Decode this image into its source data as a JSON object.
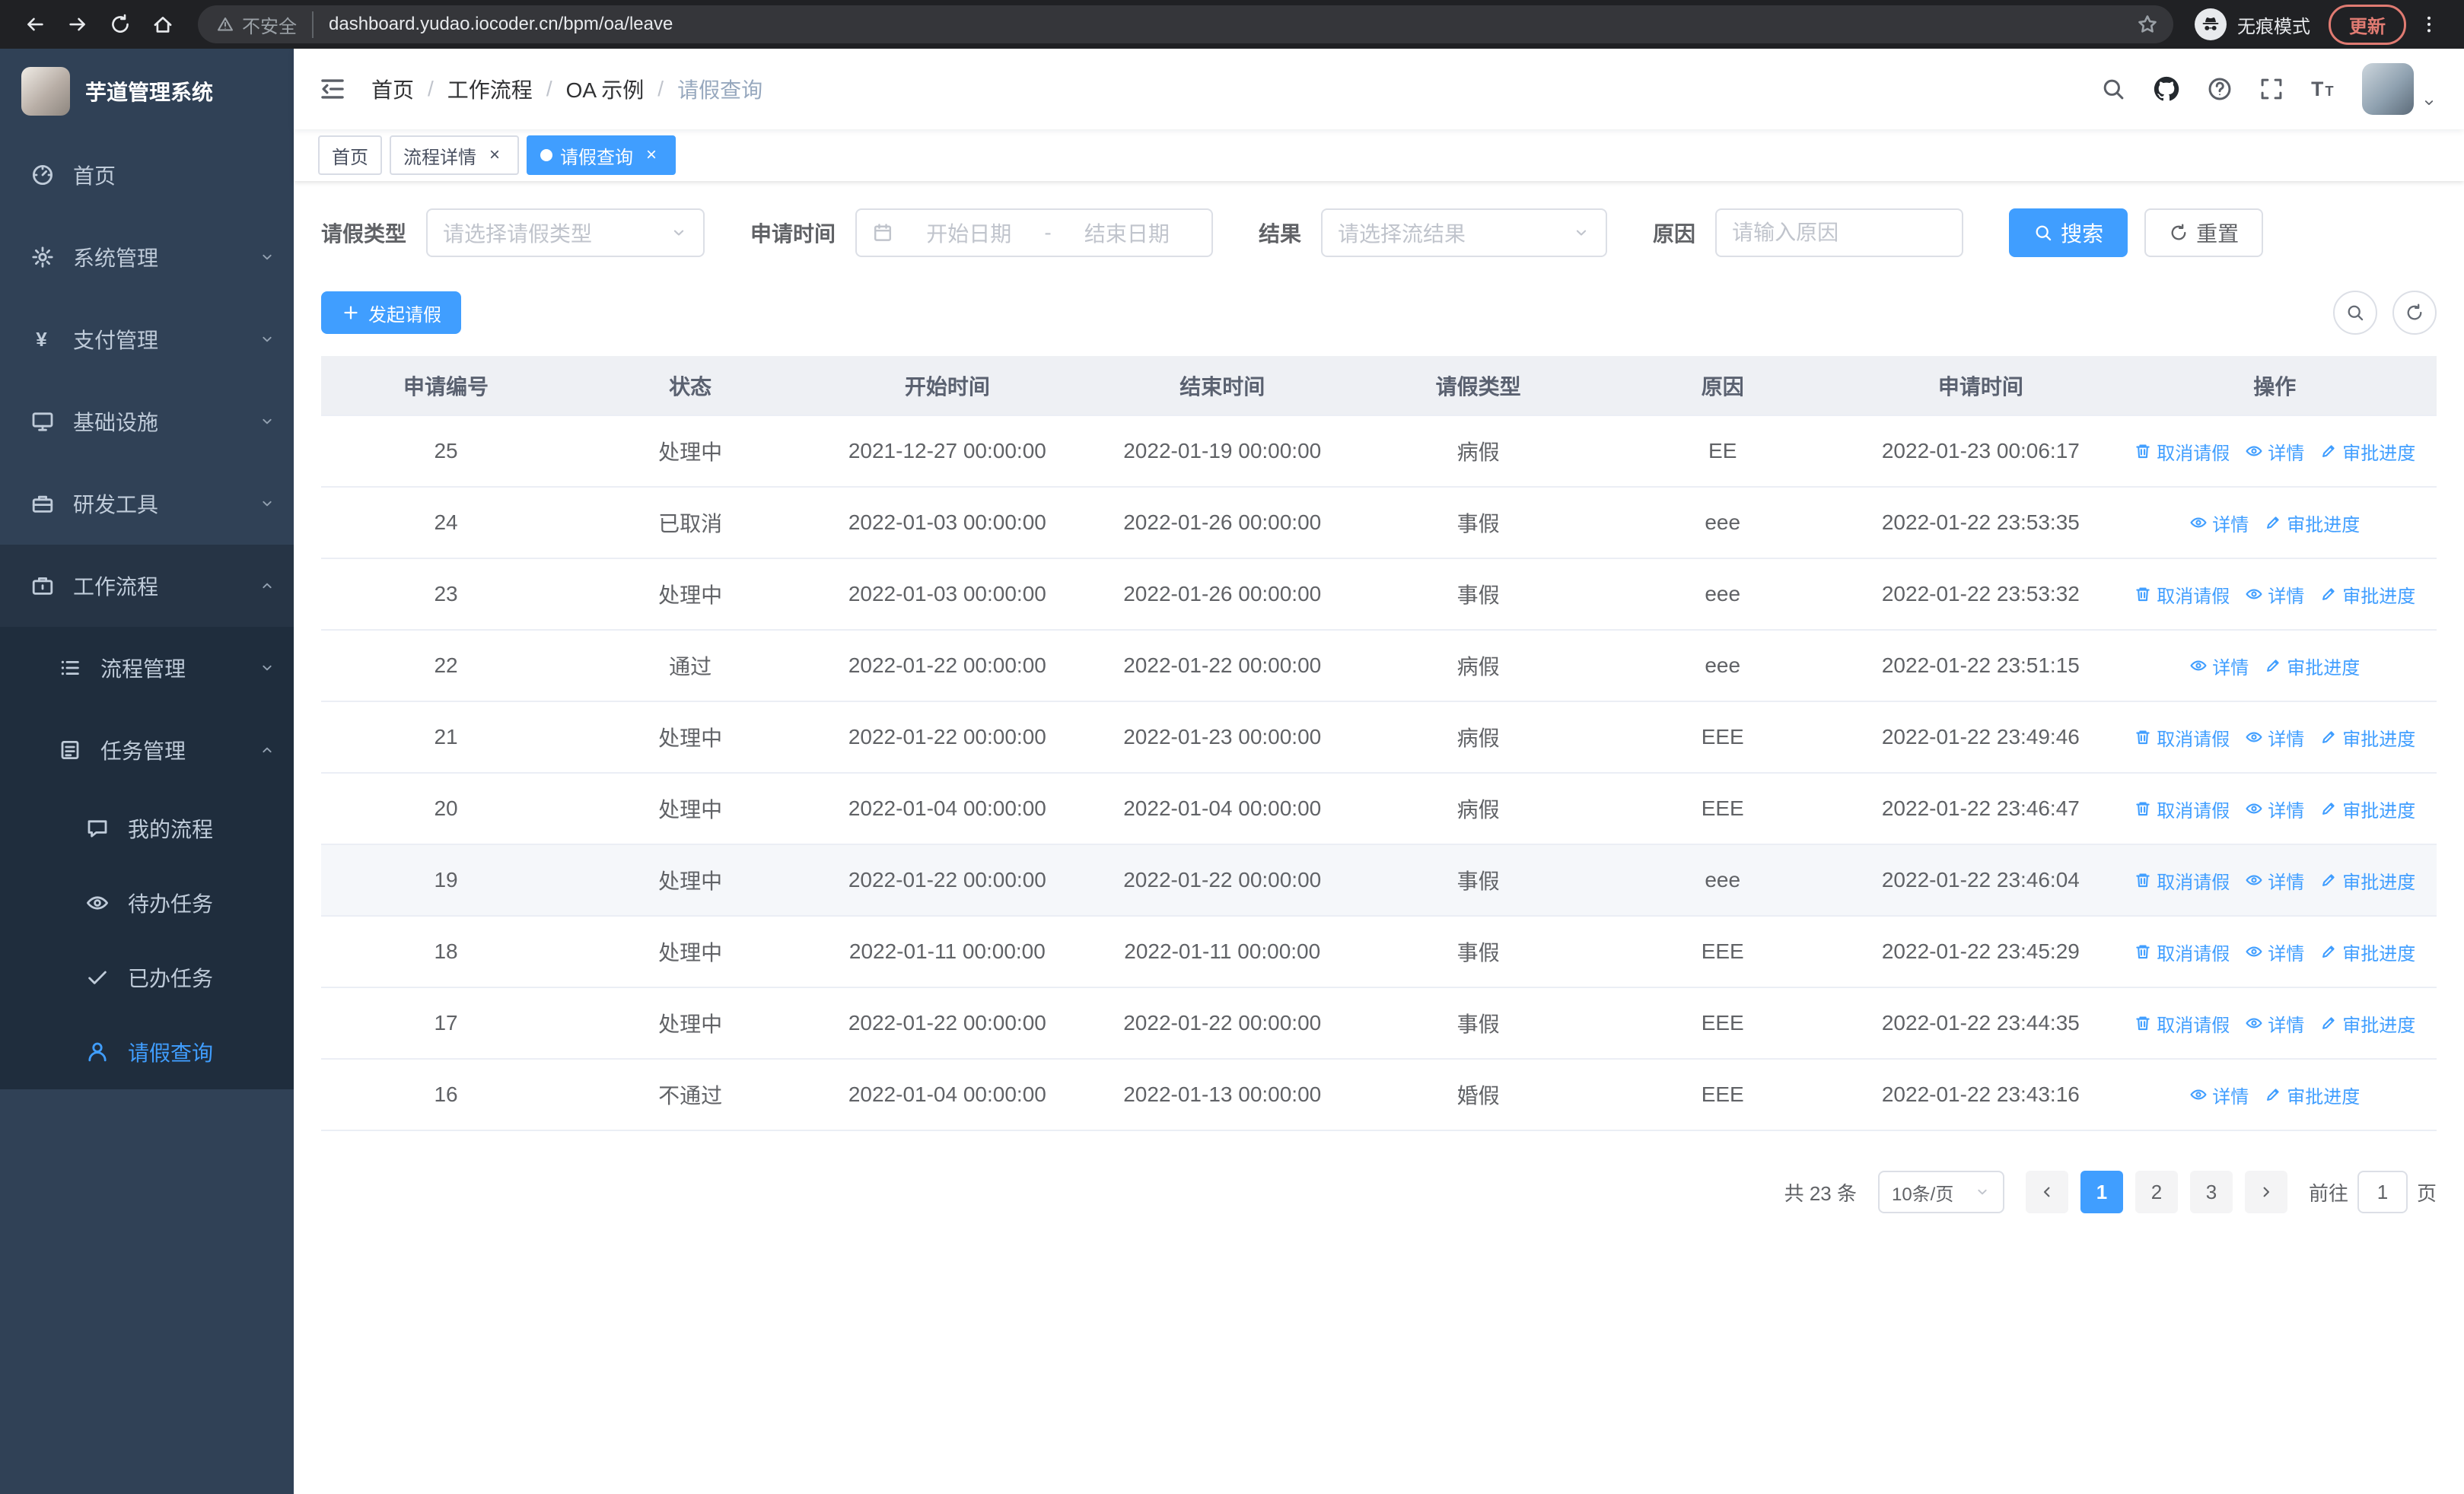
{
  "colors": {
    "accent": "#409eff",
    "sidebar_bg": "#304156",
    "sidebar_submenu_bg": "#1f2d3d",
    "table_header_bg": "#eef0f4",
    "row_highlight_bg": "#f5f7fa",
    "link": "#409eff"
  },
  "browser": {
    "security_label": "不安全",
    "url": "dashboard.yudao.iocoder.cn/bpm/oa/leave",
    "incognito_label": "无痕模式",
    "update_label": "更新"
  },
  "sidebar": {
    "logo_title": "芋道管理系统",
    "menu": [
      {
        "key": "home",
        "label": "首页",
        "icon": "dashboard-icon",
        "level": 1
      },
      {
        "key": "system",
        "label": "系统管理",
        "icon": "gear-icon",
        "level": 1,
        "arrow": "down"
      },
      {
        "key": "payment",
        "label": "支付管理",
        "icon": "yen-icon",
        "level": 1,
        "arrow": "down"
      },
      {
        "key": "infrastructure",
        "label": "基础设施",
        "icon": "monitor-icon",
        "level": 1,
        "arrow": "down"
      },
      {
        "key": "devtools",
        "label": "研发工具",
        "icon": "toolbox-icon",
        "level": 1,
        "arrow": "down"
      },
      {
        "key": "workflow",
        "label": "工作流程",
        "icon": "briefcase-icon",
        "level": 1,
        "arrow": "up",
        "open": true
      },
      {
        "key": "process-management",
        "label": "流程管理",
        "icon": "flow-icon",
        "level": 2,
        "arrow": "down"
      },
      {
        "key": "task-management",
        "label": "任务管理",
        "icon": "task-icon",
        "level": 2,
        "arrow": "up"
      },
      {
        "key": "my-process",
        "label": "我的流程",
        "icon": "chat-icon",
        "level": 3
      },
      {
        "key": "todo-tasks",
        "label": "待办任务",
        "icon": "eye-icon",
        "level": 3
      },
      {
        "key": "done-tasks",
        "label": "已办任务",
        "icon": "check-icon",
        "level": 3
      },
      {
        "key": "leave-query",
        "label": "请假查询",
        "icon": "user-icon",
        "level": 3,
        "active": true
      }
    ]
  },
  "header": {
    "breadcrumb": [
      "首页",
      "工作流程",
      "OA 示例",
      "请假查询"
    ]
  },
  "tabs": [
    {
      "key": "home",
      "label": "首页",
      "closable": false,
      "active": false
    },
    {
      "key": "process-detail",
      "label": "流程详情",
      "closable": true,
      "active": false
    },
    {
      "key": "leave-query",
      "label": "请假查询",
      "closable": true,
      "active": true
    }
  ],
  "filters": {
    "leave_type_label": "请假类型",
    "leave_type_placeholder": "请选择请假类型",
    "apply_time_label": "申请时间",
    "start_date_placeholder": "开始日期",
    "range_separator": "-",
    "end_date_placeholder": "结束日期",
    "result_label": "结果",
    "result_placeholder": "请选择流结果",
    "reason_label": "原因",
    "reason_placeholder": "请输入原因",
    "search_label": "搜索",
    "reset_label": "重置"
  },
  "toolbar": {
    "create_label": "发起请假"
  },
  "table": {
    "columns": [
      "申请编号",
      "状态",
      "开始时间",
      "结束时间",
      "请假类型",
      "原因",
      "申请时间",
      "操作"
    ],
    "actions": {
      "cancel": "取消请假",
      "detail": "详情",
      "progress": "审批进度"
    },
    "rows": [
      {
        "id": "25",
        "status": "处理中",
        "start": "2021-12-27 00:00:00",
        "end": "2022-01-19 00:00:00",
        "type": "病假",
        "reason": "EE",
        "applied": "2022-01-23 00:06:17",
        "cancellable": true,
        "highlight": false
      },
      {
        "id": "24",
        "status": "已取消",
        "start": "2022-01-03 00:00:00",
        "end": "2022-01-26 00:00:00",
        "type": "事假",
        "reason": "eee",
        "applied": "2022-01-22 23:53:35",
        "cancellable": false,
        "highlight": false
      },
      {
        "id": "23",
        "status": "处理中",
        "start": "2022-01-03 00:00:00",
        "end": "2022-01-26 00:00:00",
        "type": "事假",
        "reason": "eee",
        "applied": "2022-01-22 23:53:32",
        "cancellable": true,
        "highlight": false
      },
      {
        "id": "22",
        "status": "通过",
        "start": "2022-01-22 00:00:00",
        "end": "2022-01-22 00:00:00",
        "type": "病假",
        "reason": "eee",
        "applied": "2022-01-22 23:51:15",
        "cancellable": false,
        "highlight": false
      },
      {
        "id": "21",
        "status": "处理中",
        "start": "2022-01-22 00:00:00",
        "end": "2022-01-23 00:00:00",
        "type": "病假",
        "reason": "EEE",
        "applied": "2022-01-22 23:49:46",
        "cancellable": true,
        "highlight": false
      },
      {
        "id": "20",
        "status": "处理中",
        "start": "2022-01-04 00:00:00",
        "end": "2022-01-04 00:00:00",
        "type": "病假",
        "reason": "EEE",
        "applied": "2022-01-22 23:46:47",
        "cancellable": true,
        "highlight": false
      },
      {
        "id": "19",
        "status": "处理中",
        "start": "2022-01-22 00:00:00",
        "end": "2022-01-22 00:00:00",
        "type": "事假",
        "reason": "eee",
        "applied": "2022-01-22 23:46:04",
        "cancellable": true,
        "highlight": true
      },
      {
        "id": "18",
        "status": "处理中",
        "start": "2022-01-11 00:00:00",
        "end": "2022-01-11 00:00:00",
        "type": "事假",
        "reason": "EEE",
        "applied": "2022-01-22 23:45:29",
        "cancellable": true,
        "highlight": false
      },
      {
        "id": "17",
        "status": "处理中",
        "start": "2022-01-22 00:00:00",
        "end": "2022-01-22 00:00:00",
        "type": "事假",
        "reason": "EEE",
        "applied": "2022-01-22 23:44:35",
        "cancellable": true,
        "highlight": false
      },
      {
        "id": "16",
        "status": "不通过",
        "start": "2022-01-04 00:00:00",
        "end": "2022-01-13 00:00:00",
        "type": "婚假",
        "reason": "EEE",
        "applied": "2022-01-22 23:43:16",
        "cancellable": false,
        "highlight": false
      }
    ]
  },
  "pagination": {
    "total_label": "共 23 条",
    "page_size": "10条/页",
    "pages": [
      "1",
      "2",
      "3"
    ],
    "active_page": "1",
    "goto_label": "前往",
    "goto_value": "1",
    "page_unit": "页"
  }
}
